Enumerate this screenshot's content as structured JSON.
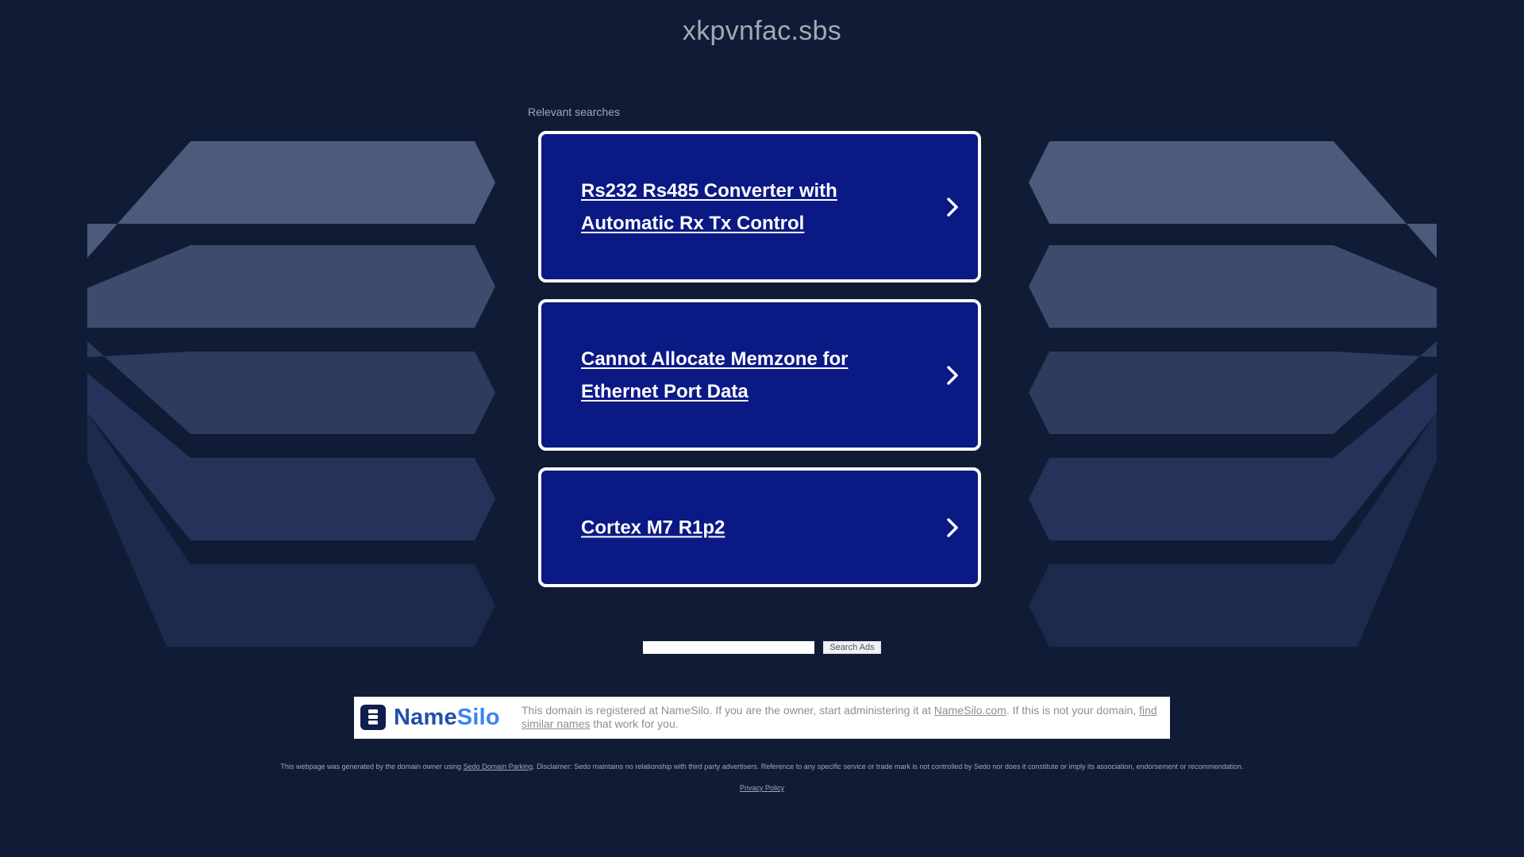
{
  "site": {
    "domain": "xkpvnfac.sbs"
  },
  "relevant": {
    "label": "Relevant searches",
    "items": [
      {
        "label": "Rs232 Rs485 Converter with Automatic Rx Tx Control"
      },
      {
        "label": "Cannot Allocate Memzone for Ethernet Port Data"
      },
      {
        "label": "Cortex M7 R1p2"
      }
    ]
  },
  "search": {
    "value": "",
    "button_label": "Search Ads"
  },
  "registrar": {
    "logo_text_main": "Name",
    "logo_text_accent": "Silo",
    "text_before": "This domain is registered at NameSilo. If you are the owner, start administering it at ",
    "link_namesilo": "NameSilo.com",
    "text_middle": ". If this is not your domain, ",
    "link_similar": "find similar names",
    "text_after": " that work for you."
  },
  "footer": {
    "text_before": "This webpage was generated by the domain owner using ",
    "link_sedo": "Sedo Domain Parking",
    "text_after": ". Disclaimer: Sedo maintains no relationship with third party advertisers. Reference to any specific service or trade mark is not controlled by Sedo nor does it constitute or imply its association, endorsement or recommendation.",
    "privacy_label": "Privacy Policy"
  },
  "colors": {
    "background": "#101c36",
    "card": "#0b1985",
    "card_border": "#ffffff",
    "muted_text": "#a2a9b4"
  },
  "icons": {
    "card_arrow": "chevron-right-icon",
    "logo": "namesilo-logo"
  }
}
